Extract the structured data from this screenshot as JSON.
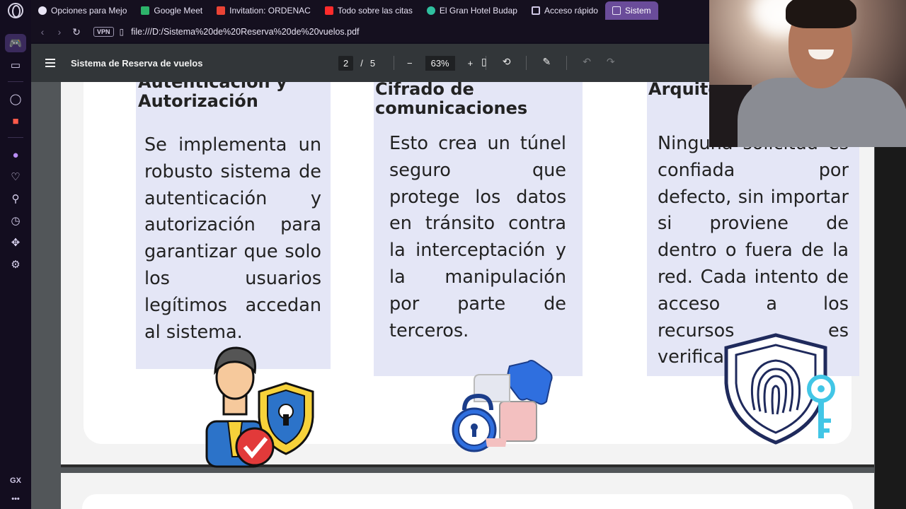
{
  "browser": {
    "tabs": [
      {
        "label": "Opciones para Mejo",
        "color": "#e9e5f5"
      },
      {
        "label": "Google Meet",
        "color": "#2db36a"
      },
      {
        "label": "Invitation: ORDENAC",
        "color": "#ea4335"
      },
      {
        "label": "Todo sobre las citas",
        "color": "#ff2b2b"
      },
      {
        "label": "El Gran Hotel Budap",
        "color": "#2fbf9f"
      },
      {
        "label": "Acceso rápido",
        "color": "#cfc7e5"
      },
      {
        "label": "Sistem",
        "color": "#cfc7e5"
      }
    ],
    "vpn_label": "VPN",
    "url": "file:///D:/Sistema%20de%20Reserva%20de%20vuelos.pdf",
    "sidebar_bottom_label": "GX"
  },
  "pdf": {
    "title": "Sistema de Reserva de vuelos",
    "current_page": "2",
    "page_sep": "/",
    "total_pages": "5",
    "zoom": "63%"
  },
  "content": {
    "col1": {
      "heading": "Autenticación y Autorización",
      "body": "Se implementa un robusto sistema de autenticación y autorización para garantizar que solo los usuarios legítimos accedan al sistema."
    },
    "col2": {
      "heading": "Cifrado de comunicaciones",
      "body": "Esto crea un túnel seguro que protege los datos en tránsito contra la interceptación y la manipulación por parte de terceros."
    },
    "col3": {
      "heading": "Arquitectu Trust",
      "body": "Ninguna solicitud es confiada por defecto, sin importar si proviene de dentro o fuera de la red. Cada intento de acceso a los recursos es verificado"
    }
  }
}
